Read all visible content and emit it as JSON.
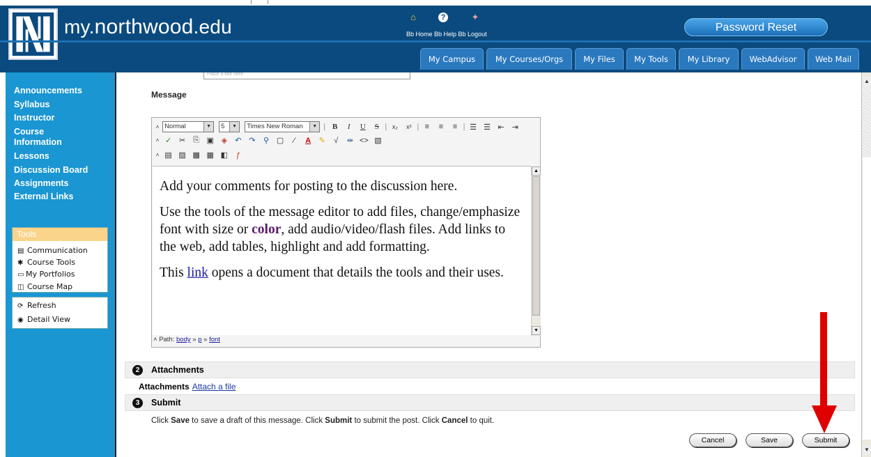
{
  "header": {
    "site_title_prefix": "my.",
    "site_title_main": "northwood",
    "site_title_suffix": ".edu",
    "bb_links": "Bb Home Bb Help Bb Logout",
    "password_reset": "Password Reset",
    "tabs": [
      "My Campus",
      "My Courses/Orgs",
      "My Files",
      "My Tools",
      "My Library",
      "WebAdvisor",
      "Web Mail"
    ]
  },
  "sidebar": {
    "nav": [
      "Announcements",
      "Syllabus",
      "Instructor",
      "Course Information",
      "Lessons",
      "Discussion Board",
      "Assignments",
      "External Links"
    ],
    "tools_header": "Tools",
    "tools": [
      "Communication",
      "Course Tools",
      "My Portfolios",
      "Course Map"
    ],
    "tools2": [
      "Refresh",
      "Detail View"
    ]
  },
  "form": {
    "partial_input": "Place a title here",
    "message_label": "Message",
    "format_select": "Normal",
    "size_select": "5",
    "font_select": "Times New Roman",
    "editor_p1": "Add your comments for posting to the discussion here.",
    "editor_p2_a": "Use the tools of the message editor to add files, change/emphasize font with size or ",
    "editor_p2_color": "color",
    "editor_p2_b": ", add audio/video/flash files.  Add links to the web, add tables, highlight and add formatting.",
    "editor_p3_a": "This ",
    "editor_p3_link": "link",
    "editor_p3_b": "  opens a document that details the tools and their uses.",
    "path_label": "Path:",
    "path_body": "body",
    "path_p": "p",
    "path_font": "font",
    "path_sep": "»"
  },
  "sections": {
    "attachments_num": "2",
    "attachments_title": "Attachments",
    "attachments_label": "Attachments",
    "attach_link": "Attach a file",
    "submit_num": "3",
    "submit_title": "Submit",
    "instr_1": "Click ",
    "instr_save": "Save",
    "instr_2": " to save a draft of this message. Click ",
    "instr_submit": "Submit",
    "instr_3": " to submit the post. Click ",
    "instr_cancel": "Cancel",
    "instr_4": " to quit."
  },
  "buttons": {
    "cancel": "Cancel",
    "save": "Save",
    "submit": "Submit"
  },
  "colors": {
    "header": "#0b4a7e",
    "sidebar": "#1a96d2",
    "arrow": "#e00000"
  }
}
